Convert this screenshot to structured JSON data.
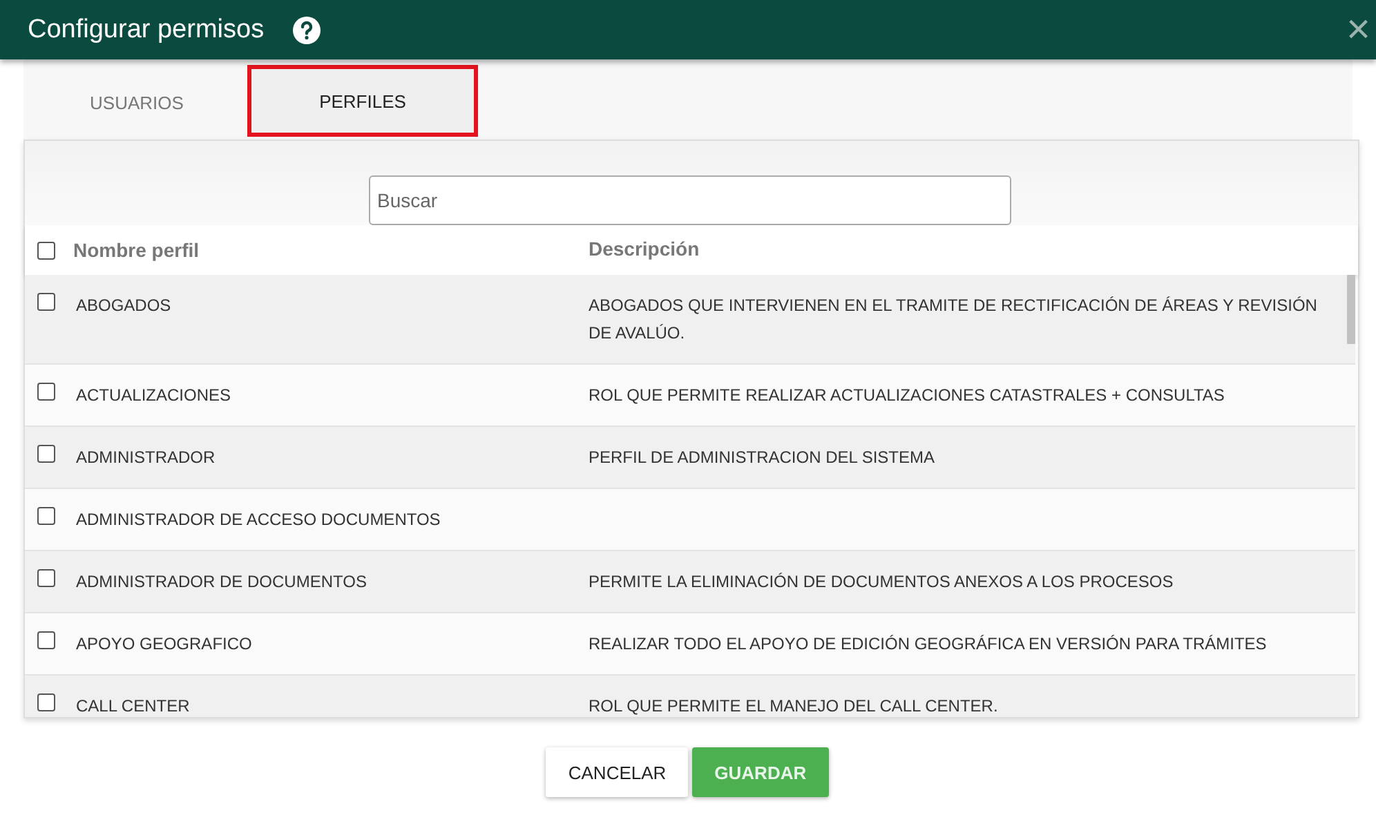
{
  "window": {
    "title": "Configurar permisos",
    "close": "×"
  },
  "tabs": [
    {
      "label": "USUARIOS",
      "selected": false,
      "highlighted": false
    },
    {
      "label": "PERFILES",
      "selected": true,
      "highlighted": true
    }
  ],
  "search": {
    "placeholder": "Buscar"
  },
  "table": {
    "select_all": {
      "checked": false
    },
    "columns": [
      "Nombre perfil",
      "Descripción"
    ],
    "rows": [
      {
        "name": "ABOGADOS",
        "description": "ABOGADOS QUE INTERVIENEN EN EL TRAMITE DE RECTIFICACIÓN DE ÁREAS Y REVISIÓN DE AVALÚO.",
        "checked": false
      },
      {
        "name": "ACTUALIZACIONES",
        "description": "ROL QUE PERMITE REALIZAR ACTUALIZACIONES CATASTRALES + CONSULTAS",
        "checked": false
      },
      {
        "name": "ADMINISTRADOR",
        "description": "PERFIL DE ADMINISTRACION DEL SISTEMA",
        "checked": false
      },
      {
        "name": "ADMINISTRADOR DE ACCESO DOCUMENTOS",
        "checked": false
      },
      {
        "name": "ADMINISTRADOR DE DOCUMENTOS",
        "description": "PERMITE LA ELIMINACIÓN DE DOCUMENTOS ANEXOS A LOS PROCESOS",
        "checked": false
      },
      {
        "name": "APOYO GEOGRAFICO",
        "description": "REALIZAR TODO EL APOYO DE EDICIÓN GEOGRÁFICA EN VERSIÓN PARA TRÁMITES",
        "checked": false
      },
      {
        "name": "CALL CENTER",
        "description": "ROL QUE PERMITE EL MANEJO DEL CALL CENTER.",
        "checked": false
      }
    ]
  },
  "buttons": [
    {
      "label": "CANCELAR",
      "kind": "secondary"
    },
    {
      "label": "GUARDAR",
      "kind": "primary"
    }
  ]
}
